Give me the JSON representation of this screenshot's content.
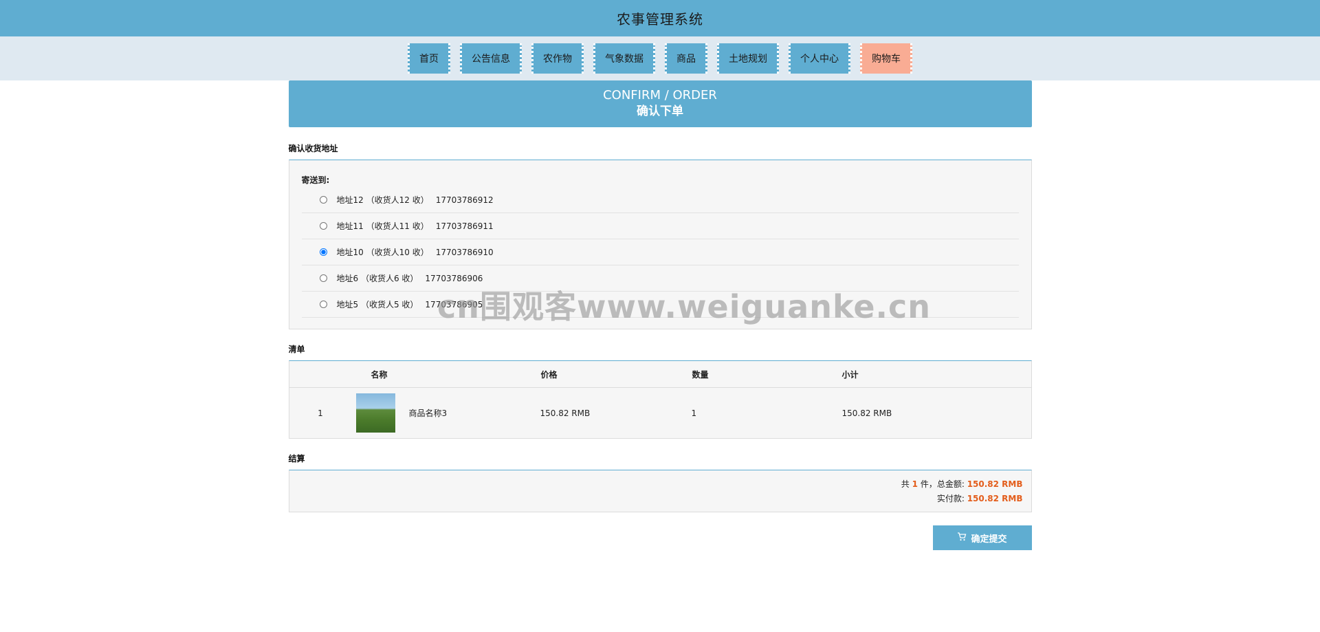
{
  "app": {
    "title": "农事管理系统"
  },
  "nav": {
    "items": [
      {
        "label": "首页"
      },
      {
        "label": "公告信息"
      },
      {
        "label": "农作物"
      },
      {
        "label": "气象数据"
      },
      {
        "label": "商品"
      },
      {
        "label": "土地规划"
      },
      {
        "label": "个人中心"
      },
      {
        "label": "购物车",
        "active": true
      }
    ]
  },
  "banner": {
    "en": "CONFIRM / ORDER",
    "cn": "确认下单"
  },
  "address_section": {
    "title": "确认收货地址",
    "ship_to": "寄送到:",
    "options": [
      {
        "name": "地址12",
        "receiver": "（收货人12 收）",
        "phone": "17703786912",
        "selected": false
      },
      {
        "name": "地址11",
        "receiver": "（收货人11 收）",
        "phone": "17703786911",
        "selected": false
      },
      {
        "name": "地址10",
        "receiver": "（收货人10 收）",
        "phone": "17703786910",
        "selected": true
      },
      {
        "name": "地址6",
        "receiver": "（收货人6 收）",
        "phone": "17703786906",
        "selected": false
      },
      {
        "name": "地址5",
        "receiver": "（收货人5 收）",
        "phone": "17703786905",
        "selected": false
      }
    ]
  },
  "list_section": {
    "title": "清单",
    "headers": {
      "name": "名称",
      "price": "价格",
      "qty": "数量",
      "subtotal": "小计"
    },
    "rows": [
      {
        "index": "1",
        "name": "商品名称3",
        "price": "150.82 RMB",
        "qty": "1",
        "subtotal": "150.82 RMB"
      }
    ]
  },
  "settle_section": {
    "title": "结算",
    "count_prefix": "共",
    "count": "1",
    "count_suffix": "件，总金额:",
    "total": "150.82 RMB",
    "paid_label": "实付款:",
    "paid": "150.82 RMB"
  },
  "submit": {
    "label": "确定提交"
  },
  "watermark": "cn围观客www.weiguanke.cn",
  "colors": {
    "primary": "#5fadd1",
    "active_nav": "#f9ac94",
    "amount": "#e35d1b"
  },
  "icons": {
    "submit": "cart-icon"
  }
}
